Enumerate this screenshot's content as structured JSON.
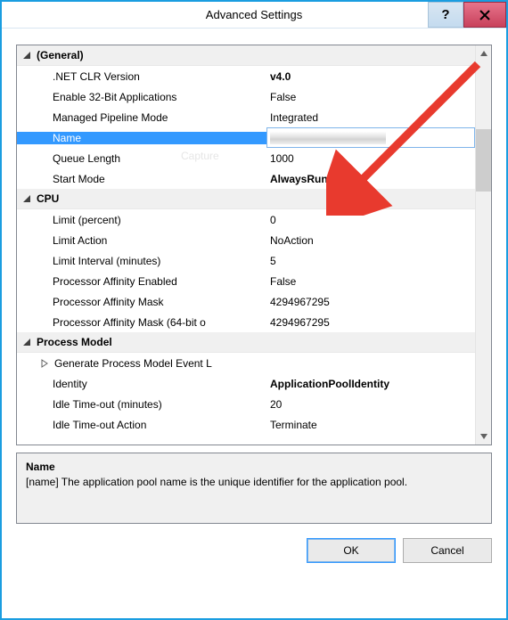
{
  "title": "Advanced Settings",
  "buttons": {
    "ok": "OK",
    "cancel": "Cancel"
  },
  "description": {
    "title": "Name",
    "text": "[name] The application pool name is the unique identifier for the application pool."
  },
  "sections": [
    {
      "key": "general",
      "title": "(General)",
      "rows": [
        {
          "label": ".NET CLR Version",
          "value": "v4.0",
          "bold": true
        },
        {
          "label": "Enable 32-Bit Applications",
          "value": "False"
        },
        {
          "label": "Managed Pipeline Mode",
          "value": "Integrated"
        },
        {
          "label": "Name",
          "value": "",
          "selected": true,
          "redacted": true
        },
        {
          "label": "Queue Length",
          "value": "1000"
        },
        {
          "label": "Start Mode",
          "value": "AlwaysRunning",
          "bold": true
        }
      ]
    },
    {
      "key": "cpu",
      "title": "CPU",
      "rows": [
        {
          "label": "Limit (percent)",
          "value": "0"
        },
        {
          "label": "Limit Action",
          "value": "NoAction"
        },
        {
          "label": "Limit Interval (minutes)",
          "value": "5"
        },
        {
          "label": "Processor Affinity Enabled",
          "value": "False"
        },
        {
          "label": "Processor Affinity Mask",
          "value": "4294967295"
        },
        {
          "label": "Processor Affinity Mask (64-bit o",
          "value": "4294967295"
        }
      ]
    },
    {
      "key": "process_model",
      "title": "Process Model",
      "rows": [
        {
          "label": "Generate Process Model Event L",
          "value": "",
          "expander": true
        },
        {
          "label": "Identity",
          "value": "ApplicationPoolIdentity",
          "bold": true
        },
        {
          "label": "Idle Time-out (minutes)",
          "value": "20"
        },
        {
          "label": "Idle Time-out Action",
          "value": "Terminate"
        }
      ]
    }
  ],
  "watermark": "Capture"
}
